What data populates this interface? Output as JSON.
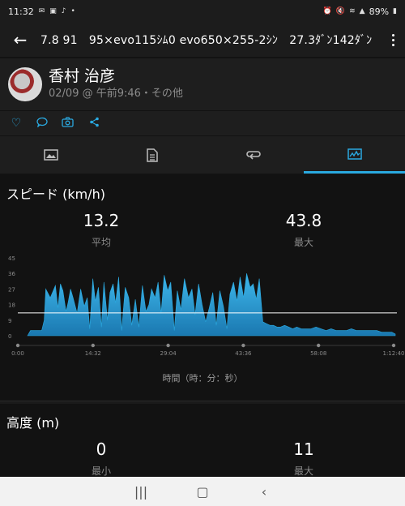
{
  "status_bar": {
    "time": "11:32",
    "battery": "89%"
  },
  "header": {
    "title": "7.8 91　95×evo115ｼﾑ0 evo650×255-2ｼﾝ　27.3ﾀﾞﾝ142ﾀﾞﾝ"
  },
  "profile": {
    "name": "香村 治彦",
    "meta": "02/09 @ 午前9:46・その他"
  },
  "speed": {
    "title": "スピード (km/h)",
    "avg_value": "13.2",
    "avg_label": "平均",
    "max_value": "43.8",
    "max_label": "最大"
  },
  "chart_data": {
    "type": "area",
    "title": "スピード (km/h)",
    "xlabel": "時間（時：分：秒）",
    "ylabel": "",
    "y_ticks": [
      "45",
      "36",
      "27",
      "18",
      "9",
      "0"
    ],
    "x_ticks": [
      "0:00",
      "14:32",
      "29:04",
      "43:36",
      "58:08",
      "1:12:40"
    ],
    "ylim": [
      0,
      45
    ],
    "average_line": 13.2,
    "color": "#2aa9e0",
    "x": [
      0,
      0.6,
      2.8,
      3.3,
      3.6,
      4.5,
      5.5,
      6.0,
      6.5,
      7.0,
      7.6,
      8.0,
      8.5,
      9.0,
      9.8,
      10.5,
      11.2,
      11.8,
      12.3,
      12.9,
      13.4,
      14.0,
      14.6,
      15.1,
      15.8,
      16.3,
      16.9,
      17.4,
      18.0,
      18.6,
      19.3,
      20.0,
      20.6,
      21.3,
      22.0,
      22.7,
      23.4,
      24.0,
      24.5,
      25.2,
      25.8,
      26.4,
      27.0,
      27.7,
      28.3,
      29.0,
      29.6,
      30.3,
      31.0,
      31.8,
      32.5,
      33.1,
      33.8,
      34.5,
      35.2,
      35.9,
      36.6,
      37.3,
      38.0,
      38.7,
      39.4,
      40.0,
      40.7,
      41.4,
      42.0,
      42.7,
      43.3,
      44.0,
      44.6,
      45.2,
      45.8,
      46.5,
      47.2,
      47.9,
      48.6,
      49.3,
      50.0,
      50.8,
      51.6,
      52.4,
      53.2,
      54.1,
      55.0,
      56.0,
      57.0,
      58.0,
      59.0,
      60.0,
      61.0,
      62.0,
      63.0,
      64.0,
      65.0,
      66.0,
      67.0,
      68.0,
      69.0,
      70.0,
      71.0,
      72.0,
      72.67
    ],
    "y": [
      0,
      3,
      3,
      9,
      27,
      22,
      29,
      16,
      30,
      26,
      14,
      19,
      27,
      22,
      13,
      27,
      17,
      22,
      4,
      33,
      20,
      28,
      5,
      31,
      9,
      25,
      30,
      19,
      34,
      3,
      28,
      22,
      6,
      21,
      5,
      29,
      14,
      18,
      27,
      22,
      31,
      13,
      35,
      26,
      31,
      3,
      26,
      15,
      33,
      22,
      27,
      12,
      30,
      18,
      8,
      16,
      25,
      6,
      26,
      17,
      4,
      24,
      31,
      20,
      34,
      22,
      36,
      28,
      30,
      21,
      33,
      8,
      7,
      6,
      6,
      5,
      5,
      6,
      5,
      4,
      5,
      4,
      4,
      4,
      5,
      4,
      3,
      4,
      3,
      3,
      3,
      4,
      3,
      3,
      3,
      3,
      3,
      2,
      2,
      2,
      1
    ]
  },
  "altitude": {
    "title": "高度 (m)",
    "min_value": "0",
    "min_label": "最小",
    "max_value": "11",
    "max_label": "最大"
  }
}
